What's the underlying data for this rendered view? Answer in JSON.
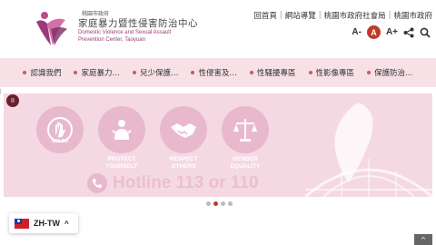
{
  "logo": {
    "small": "桃園市政府",
    "title": "家庭暴力暨性侵害防治中心",
    "en_line1": "Domestic Violence and Sexual Assault",
    "en_line2": "Prevention Center, Taoyuan"
  },
  "toplinks": [
    "回首頁",
    "網站導覽",
    "桃園市政府社會局",
    "桃園市政府"
  ],
  "tools": {
    "font_small": "A-",
    "font_medium": "A",
    "font_large": "A+"
  },
  "nav": [
    "認識我們",
    "家庭暴力…",
    "兒少保護…",
    "性侵害及…",
    "性騷擾專區",
    "性影像專區",
    "保護防治…"
  ],
  "banner": {
    "pause": "II",
    "circles": [
      {
        "icon": "say-no-hand-icon",
        "label": "SAY NO",
        "sub": ""
      },
      {
        "icon": "protect-person-icon",
        "label": "PROTECT",
        "sub": "YOURSELF"
      },
      {
        "icon": "handshake-icon",
        "label": "RESPECT",
        "sub": "OTHERS"
      },
      {
        "icon": "scales-icon",
        "label": "GENDER",
        "sub": "EQUALITY"
      }
    ],
    "hotline": "Hotline 113 or 110"
  },
  "carousel": {
    "count": 4,
    "active": 1
  },
  "language": {
    "label": "ZH-TW"
  },
  "colors": {
    "accent": "#c0392b",
    "nav_bg": "#f7e1e7",
    "banner_bg": "#f4d9e3"
  }
}
